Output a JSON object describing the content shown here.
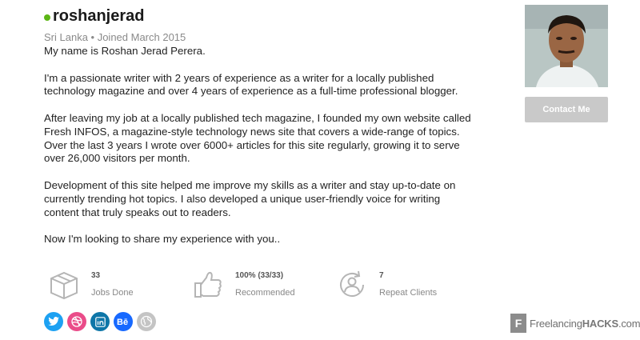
{
  "profile": {
    "username": "roshanjerad",
    "location_joined": "Sri Lanka • Joined March 2015",
    "contact_label": "Contact Me"
  },
  "bio": {
    "paragraphs": [
      "My name is Roshan Jerad Perera.",
      "I'm a passionate writer with 2 years of experience as a writer for a locally published technology magazine and over 4 years of experience as a full-time professional blogger.",
      "After leaving my job at a locally published tech magazine, I founded my own website called Fresh INFOS, a magazine-style technology news site that covers a wide-range of topics. Over the last 3 years I wrote over 6000+ articles for this site regularly, growing it to serve over 26,000 visitors per month.",
      "Development of this site helped me improve my skills as a writer and stay up-to-date on currently trending hot topics. I also developed a unique user-friendly voice for writing content that truly speaks out to readers.",
      "Now I'm looking to share my experience with you.."
    ]
  },
  "stats": [
    {
      "value": "33",
      "label": "Jobs Done",
      "icon": "box-icon"
    },
    {
      "value": "100% (33/33)",
      "label": "Recommended",
      "icon": "thumbs-up-icon"
    },
    {
      "value": "7",
      "label": "Repeat Clients",
      "icon": "repeat-user-icon"
    }
  ],
  "socials": [
    {
      "name": "twitter-icon",
      "glyph": "t",
      "color": "#1da1f2"
    },
    {
      "name": "dribbble-icon",
      "glyph": "◎",
      "color": "#ea4c89"
    },
    {
      "name": "linkedin-icon",
      "glyph": "in",
      "color": "#0e76a8"
    },
    {
      "name": "behance-icon",
      "glyph": "Bē",
      "color": "#1769ff"
    },
    {
      "name": "globe-icon",
      "glyph": "",
      "color": "#c4c4c4"
    }
  ],
  "watermark": {
    "mark": "F",
    "text_prefix": "Freelancing",
    "text_strong": "HACKS",
    "text_suffix": ".com"
  },
  "colors": {
    "online_dot": "#5cb615",
    "contact_button": "#c9c9c9",
    "stat_icon": "#b5b5b5"
  }
}
